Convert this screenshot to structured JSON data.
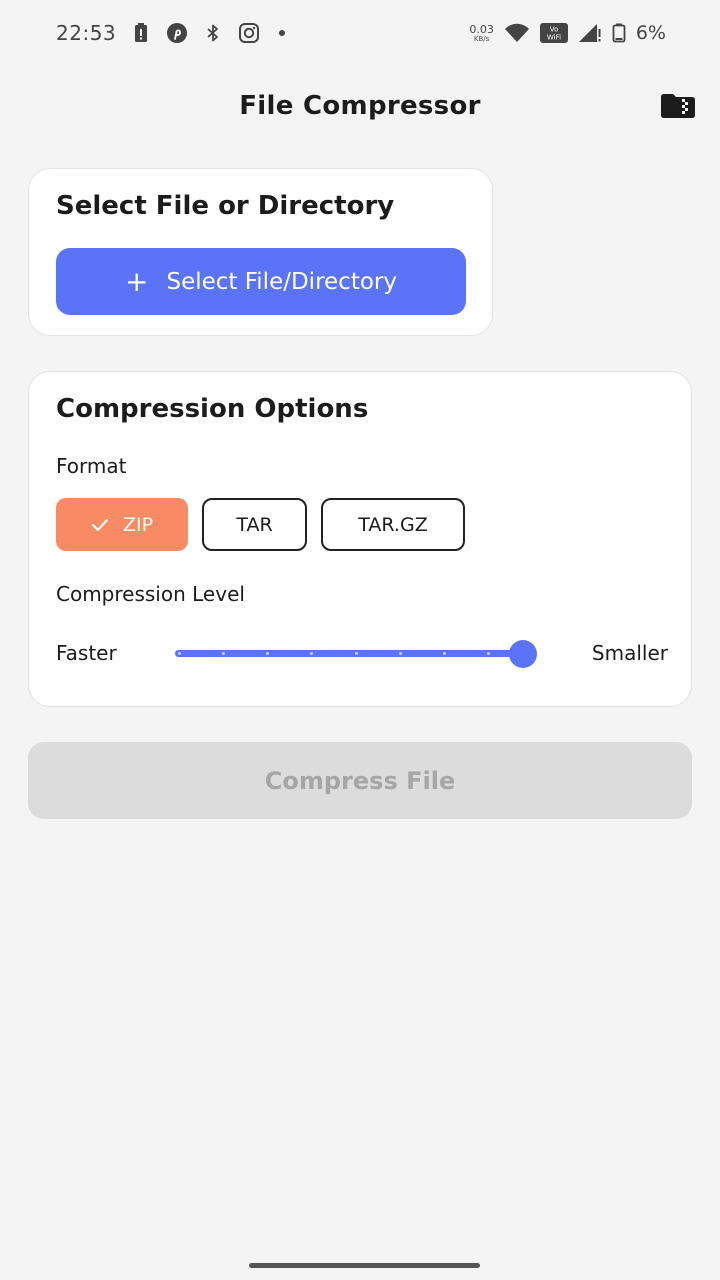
{
  "status_bar": {
    "time": "22:53",
    "net_speed_value": "0.03",
    "net_speed_unit": "KB/s",
    "battery_percent": "6%",
    "left_icons": [
      "battery-alert-icon",
      "pinterest-icon",
      "bluetooth-icon",
      "instagram-icon",
      "dot-icon"
    ],
    "right_icons": [
      "wifi-icon",
      "vowifi-icon",
      "signal-icon",
      "battery-icon"
    ]
  },
  "header": {
    "title": "File Compressor",
    "action_icon": "folder-zip-icon"
  },
  "select_card": {
    "title": "Select File or Directory",
    "button_label": "Select File/Directory",
    "button_icon": "plus-icon"
  },
  "options_card": {
    "title": "Compression Options",
    "format_label": "Format",
    "formats": [
      {
        "label": "ZIP",
        "selected": true
      },
      {
        "label": "TAR",
        "selected": false
      },
      {
        "label": "TAR.GZ",
        "selected": false
      }
    ],
    "level_label": "Compression Level",
    "level_min_label": "Faster",
    "level_max_label": "Smaller",
    "level_steps": 9,
    "level_value": 9
  },
  "compress_button": {
    "label": "Compress File",
    "enabled": false
  },
  "colors": {
    "accent": "#5b73f7",
    "chip_selected": "#f88a64",
    "background": "#f4f4f4",
    "disabled_button": "#dcdcdc"
  }
}
